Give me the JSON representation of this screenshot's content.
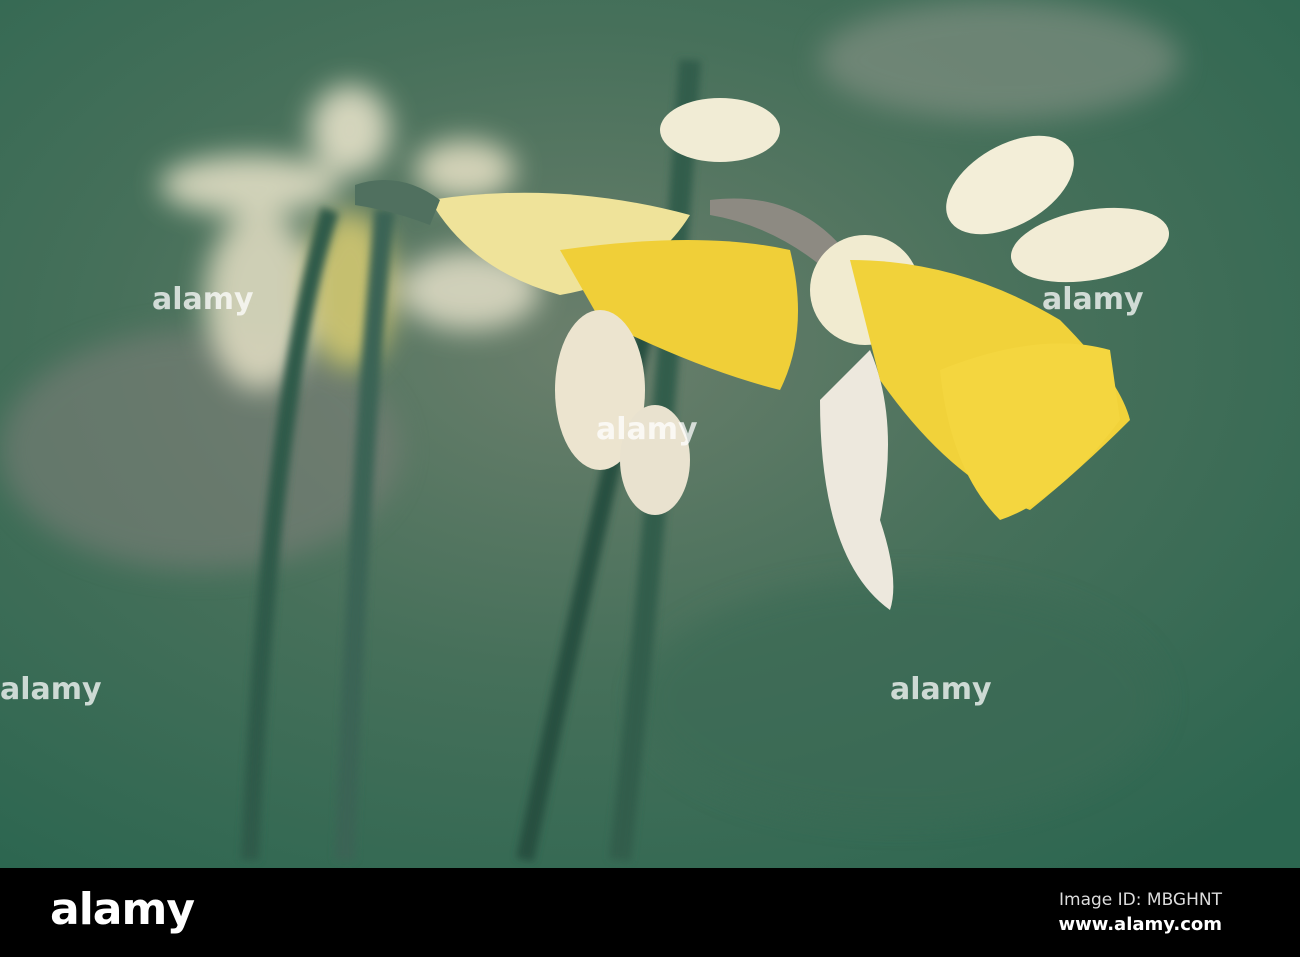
{
  "logo": "alamy",
  "watermark": "alamy",
  "footer": {
    "image_id": "Image ID: MBGHNT",
    "site": "www.alamy.com"
  },
  "colors": {
    "background": "#3f6a55",
    "petal": "#f2ecd6",
    "trumpet": "#f0d23a",
    "stem": "#2f5a48"
  }
}
